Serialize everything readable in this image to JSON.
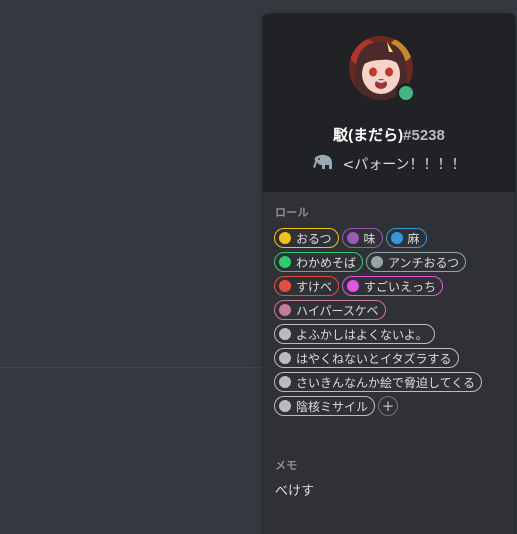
{
  "profile": {
    "username": "駁(まだら)",
    "discriminator": "#5238",
    "status_color": "#43b581",
    "custom_status_emoji": "elephant-emoji",
    "custom_status_text": "<パォーン！！！！"
  },
  "roles_section": {
    "label": "ロール",
    "roles": [
      {
        "name": "おるつ",
        "color": "#f1c40f"
      },
      {
        "name": "味",
        "color": "#9b59b6"
      },
      {
        "name": "麻",
        "color": "#3498db"
      },
      {
        "name": "わかめそば",
        "color": "#2ecc71"
      },
      {
        "name": "アンチおるつ",
        "color": "#95a5a6"
      },
      {
        "name": "すけべ",
        "color": "#e74c3c"
      },
      {
        "name": "すごいえっち",
        "color": "#e056e0"
      },
      {
        "name": "ハイパースケベ",
        "color": "#c77c95"
      },
      {
        "name": "よふかしはよくないよ。",
        "color": "#b9bbbe"
      },
      {
        "name": "はやくねないとイタズラする",
        "color": "#b9bbbe"
      },
      {
        "name": "さいきんなんか絵で脅迫してくる",
        "color": "#b9bbbe"
      },
      {
        "name": "陰核ミサイル",
        "color": "#b9bbbe"
      }
    ],
    "add_label": "+"
  },
  "note_section": {
    "label": "メモ",
    "value": "べけす"
  }
}
